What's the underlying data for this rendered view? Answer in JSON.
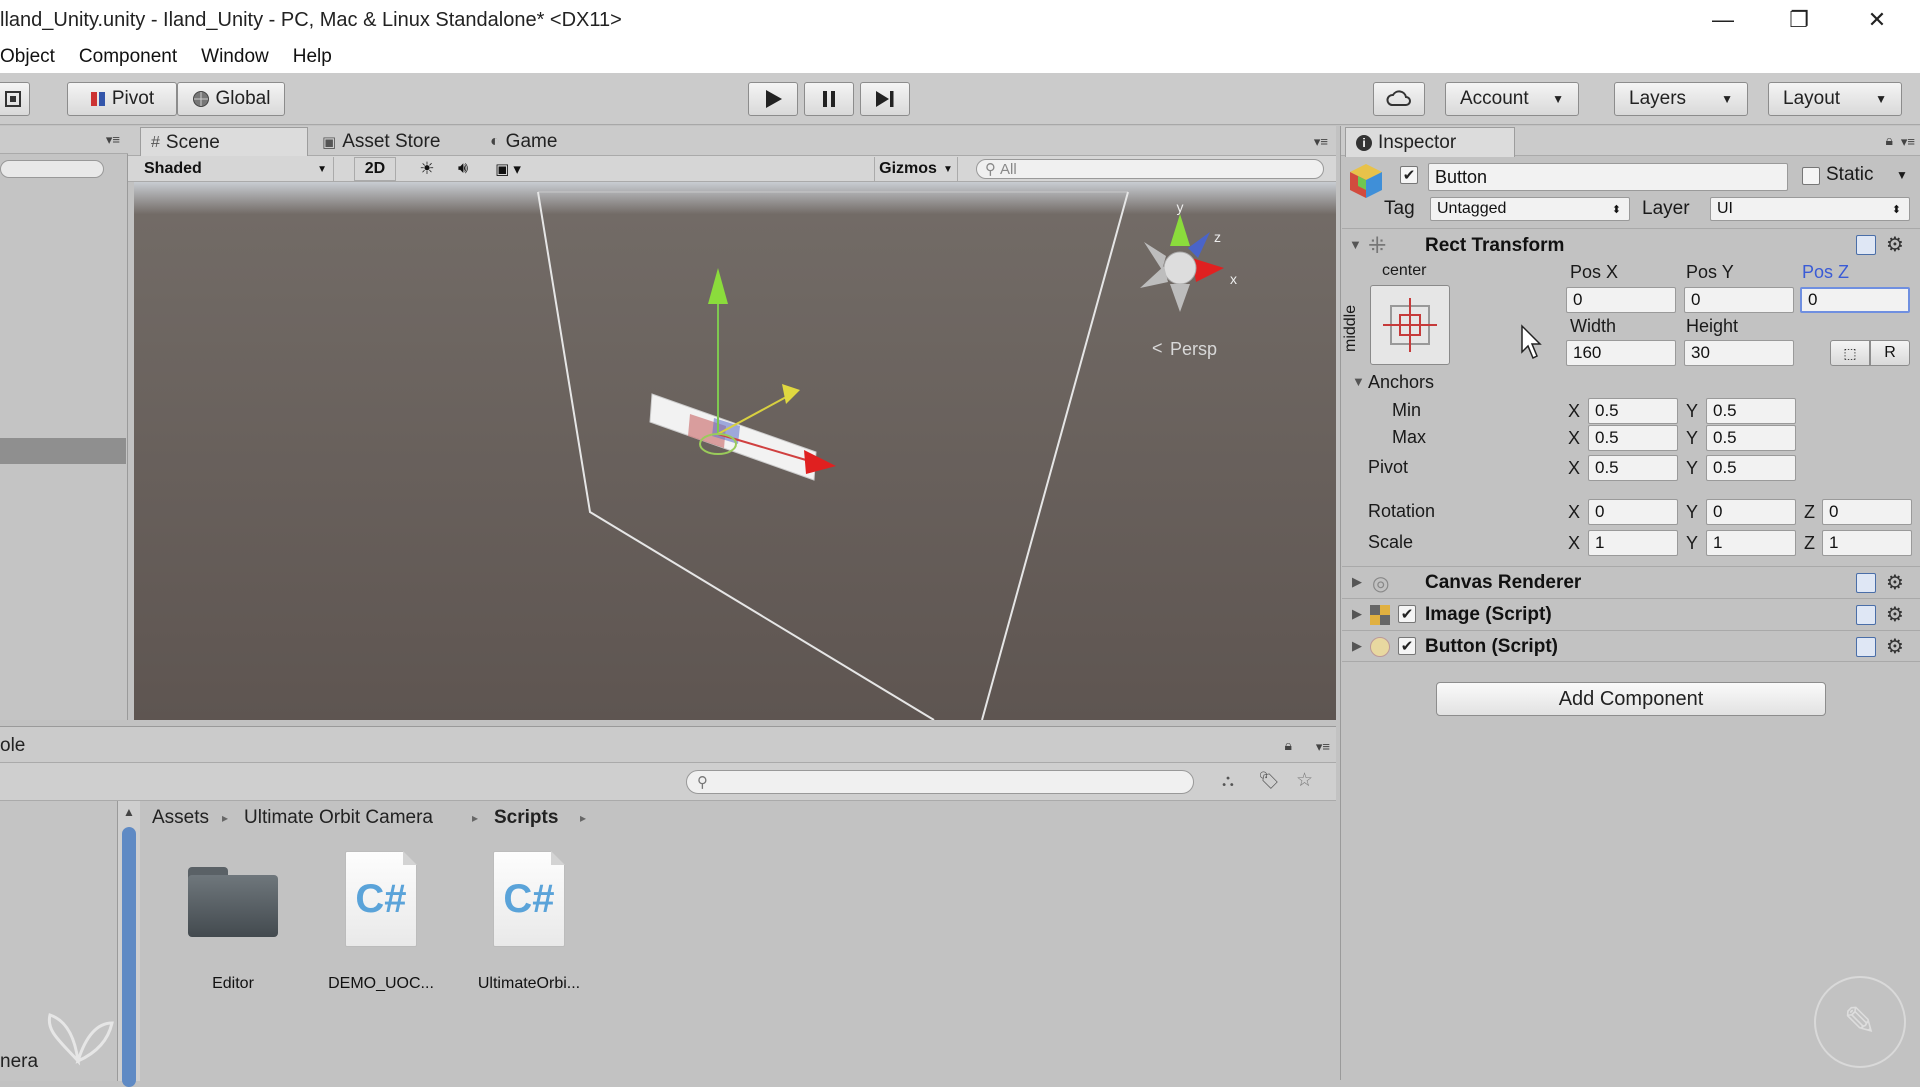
{
  "window": {
    "title": "lland_Unity.unity - Iland_Unity - PC, Mac & Linux Standalone* <DX11>",
    "minimize": "—",
    "maximize": "❐",
    "close": "✕"
  },
  "menu": [
    "Object",
    "Component",
    "Window",
    "Help"
  ],
  "toolbar": {
    "pivot_label": "Pivot",
    "global_label": "Global",
    "account_label": "Account",
    "layers_label": "Layers",
    "layout_label": "Layout"
  },
  "scene": {
    "tabs": [
      "Scene",
      "Asset Store",
      "Game"
    ],
    "shading_mode": "Shaded",
    "mode_2d": "2D",
    "gizmos_label": "Gizmos",
    "search_placeholder": "All",
    "persp_label": "Persp",
    "axis_labels": {
      "x": "x",
      "y": "y",
      "z": "z"
    }
  },
  "inspector": {
    "tab_label": "Inspector",
    "object_name": "Button",
    "static_label": "Static",
    "tag_label": "Tag",
    "tag_value": "Untagged",
    "layer_label": "Layer",
    "layer_value": "UI",
    "rect_transform": {
      "title": "Rect Transform",
      "anchor_h": "center",
      "anchor_v": "middle",
      "pos_x_label": "Pos X",
      "pos_y_label": "Pos Y",
      "pos_z_label": "Pos Z",
      "pos_x": "0",
      "pos_y": "0",
      "pos_z": "0",
      "width_label": "Width",
      "height_label": "Height",
      "width": "160",
      "height": "30",
      "r_button": "R",
      "anchors_label": "Anchors",
      "min_label": "Min",
      "max_label": "Max",
      "pivot_label": "Pivot",
      "rotation_label": "Rotation",
      "scale_label": "Scale",
      "min_x": "0.5",
      "min_y": "0.5",
      "max_x": "0.5",
      "max_y": "0.5",
      "pivot_x": "0.5",
      "pivot_y": "0.5",
      "rot_x": "0",
      "rot_y": "0",
      "rot_z": "0",
      "scale_x": "1",
      "scale_y": "1",
      "scale_z": "1",
      "x": "X",
      "y": "Y",
      "z": "Z"
    },
    "components": [
      "Canvas Renderer",
      "Image (Script)",
      "Button (Script)"
    ],
    "add_component_label": "Add Component"
  },
  "project": {
    "console_tab_fragment": "ole",
    "left_item_fragment": "nera",
    "breadcrumb": [
      "Assets",
      "Ultimate Orbit Camera",
      "Scripts"
    ],
    "assets": [
      {
        "name": "Editor",
        "icon": "folder-icon"
      },
      {
        "name": "DEMO_UOC...",
        "icon": "csharp-script-icon"
      },
      {
        "name": "UltimateOrbi...",
        "icon": "csharp-script-icon"
      }
    ],
    "script_glyph": "C#"
  }
}
